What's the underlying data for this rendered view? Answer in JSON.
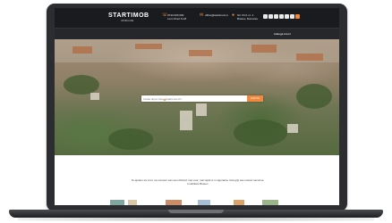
{
  "header": {
    "logo": "STARTIMOB",
    "logo_tagline": "IMOBILIARE",
    "phone": "0743 000 000",
    "phone_sub": "Luni-Vineri 9-18",
    "email": "office@startimob.ro",
    "address": "Str. Prof. nr. 1",
    "address_sub": "Brasov, Romania"
  },
  "nav": {
    "items": [
      "Vanzari ▾",
      "Inchirieri ▾",
      "Noi ▾",
      "Servicii ▾",
      "Despre",
      "Testimoniale",
      "Blog",
      "Contact",
      "Evaluare Online"
    ],
    "right_label": "Adauga Anunt"
  },
  "hero": {
    "search_placeholder": "Cauta dupa zona, strada sau ID...",
    "search_button": "CAUTA"
  },
  "about": {
    "line1": "Te ajutam sa vinzi, sa cumperi sau sa inchiriezi mai usor, mai rapid si in siguranta, fara griji sau costuri ascunse.",
    "line2": "Imobiliare Brasov"
  },
  "colors": {
    "accent": "#f0883e",
    "header_bg": "#1a1b1e",
    "nav_bg": "#26272b"
  }
}
